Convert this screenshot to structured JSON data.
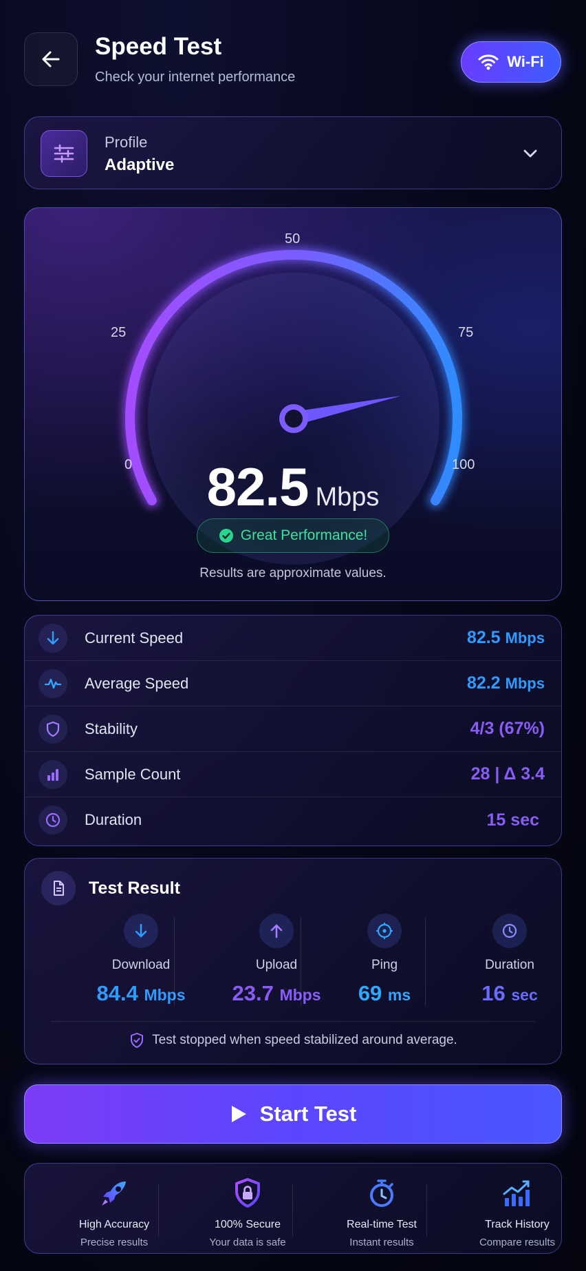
{
  "header": {
    "title": "Speed Test",
    "subtitle": "Check your internet performance",
    "network_label": "Wi-Fi"
  },
  "profile": {
    "label": "Profile",
    "value": "Adaptive"
  },
  "gauge": {
    "ticks": [
      "0",
      "25",
      "50",
      "75",
      "100"
    ],
    "speed_value": "82.5",
    "speed_unit": "Mbps",
    "needle_fraction": 0.825,
    "status": "Great Performance!",
    "note": "Results are approximate values."
  },
  "stats": [
    {
      "icon": "arrow-down-icon",
      "label": "Current Speed",
      "value": "82.5",
      "unit": "Mbps",
      "color": "#2f9bff"
    },
    {
      "icon": "pulse-icon",
      "label": "Average Speed",
      "value": "82.2",
      "unit": "Mbps",
      "color": "#2f9bff"
    },
    {
      "icon": "shield-icon",
      "label": "Stability",
      "value": "4/3 (67%)",
      "unit": "",
      "color": "#8a5cf6"
    },
    {
      "icon": "bar-chart-icon",
      "label": "Sample Count",
      "value": "28 | Δ 3.4",
      "unit": "",
      "color": "#8a5cf6"
    },
    {
      "icon": "clock-icon",
      "label": "Duration",
      "value": "15 sec",
      "unit": "",
      "color": "#8a5cf6"
    }
  ],
  "result": {
    "title": "Test Result",
    "items": [
      {
        "icon": "arrow-down-icon",
        "label": "Download",
        "value": "84.4",
        "unit": "Mbps",
        "color": "#2f9bff"
      },
      {
        "icon": "arrow-up-icon",
        "label": "Upload",
        "value": "23.7",
        "unit": "Mbps",
        "color": "#8a5cf6"
      },
      {
        "icon": "target-icon",
        "label": "Ping",
        "value": "69",
        "unit": "ms",
        "color": "#2fa8ff"
      },
      {
        "icon": "clock-icon",
        "label": "Duration",
        "value": "16",
        "unit": "sec",
        "color": "#6b6cff"
      }
    ],
    "footer": "Test stopped when speed stabilized around average."
  },
  "start_button": {
    "label": "Start Test"
  },
  "features": [
    {
      "icon": "rocket-icon",
      "title": "High Accuracy",
      "subtitle": "Precise results"
    },
    {
      "icon": "lock-shield-icon",
      "title": "100% Secure",
      "subtitle": "Your data is safe"
    },
    {
      "icon": "stopwatch-icon",
      "title": "Real-time Test",
      "subtitle": "Instant results"
    },
    {
      "icon": "trend-chart-icon",
      "title": "Track History",
      "subtitle": "Compare results"
    }
  ]
}
